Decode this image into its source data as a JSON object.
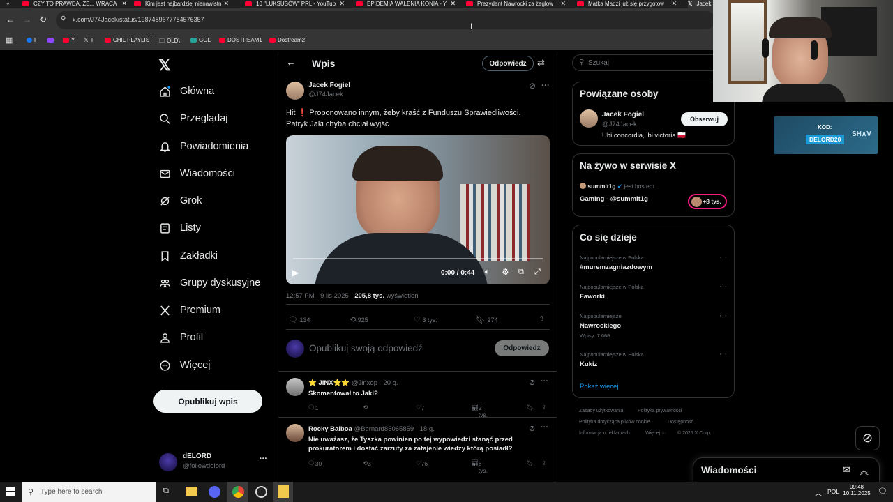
{
  "browser": {
    "tabs": [
      {
        "label": "CZY TO PRAWDA, ŻE... WRACA",
        "icon": "youtube-icon"
      },
      {
        "label": "Kim jest najbardziej nienawistn",
        "icon": "youtube-icon"
      },
      {
        "label": "10 \"LUKSUSÓW\" PRL - YouTub",
        "icon": "youtube-icon"
      },
      {
        "label": "EPIDEMIA WALENIA KONIA - Y",
        "icon": "youtube-icon"
      },
      {
        "label": "Prezydent Nawrocki za żeglow",
        "icon": "youtube-icon"
      },
      {
        "label": "Matka Madzi już się przygotow",
        "icon": "youtube-icon"
      },
      {
        "label": "Jacek",
        "icon": "x-icon"
      }
    ],
    "url": "x.com/J74Jacek/status/1987489677784576357",
    "bookmarks": [
      "F",
      "Y",
      "T",
      "CHIL PLAYLIST",
      "OLD\\",
      "GOL",
      "DOSTREAM1",
      "Dostream2"
    ]
  },
  "nav": {
    "items": [
      "Główna",
      "Przeglądaj",
      "Powiadomienia",
      "Wiadomości",
      "Grok",
      "Listy",
      "Zakładki",
      "Grupy dyskusyjne",
      "Premium",
      "Profil",
      "Więcej"
    ],
    "post_button": "Opublikuj wpis",
    "account_name": "dELORD",
    "account_handle": "@followdelord"
  },
  "header": {
    "title": "Wpis",
    "reply_button": "Odpowiedz"
  },
  "post": {
    "author_name": "Jacek Fogiel",
    "author_handle": "@J74Jacek",
    "text_line1": "Hit ❗ Proponowano innym, żeby kraść z Funduszu Sprawiedliwości.",
    "text_line2": "Patryk Jaki chyba chciał wyjść",
    "video_time": "0:00 / 0:44",
    "video_progress": 0.0,
    "timestamp": "12:57 PM · 9 lis 2025 · ",
    "views": "205,8 tys.",
    "views_label": " wyświetleń",
    "stats": {
      "replies": "134",
      "reposts": "925",
      "likes": "3 tys.",
      "bookmarks": "274"
    },
    "reply_placeholder": "Opublikuj swoją odpowiedź",
    "reply_submit": "Odpowiedz"
  },
  "replies": [
    {
      "name": "⭐ JINX⭐⭐",
      "handle": "@Jinxop · 20 g.",
      "text1": "Skomentował to Jaki?",
      "text2": "",
      "stats": [
        "1",
        "",
        "7",
        "2 tys."
      ]
    },
    {
      "name": "Rocky Balboa",
      "handle": "@Bernard85065859 · 18 g.",
      "text1": "Nie uważasz, że Tyszka powinien po tej wypowiedzi stanąć przed",
      "text2": "prokuratorem i dostać zarzuty za zatajenie wiedzy którą posiadł?",
      "stats": [
        "30",
        "3",
        "76",
        "6 tys."
      ]
    }
  ],
  "right": {
    "search_placeholder": "Szukaj",
    "related_title": "Powiązane osoby",
    "related_name": "Jacek Fogiel",
    "related_handle": "@J74Jacek",
    "related_bio": "Ubi concordia, ibi victoria 🇵🇱",
    "follow_button": "Obserwuj",
    "live_title": "Na żywo w serwisie X",
    "live_host": "summit1g",
    "live_host_label": " jest hostem",
    "live_name": "Gaming - @summit1g",
    "live_count": "+8 tys.",
    "trends_title": "Co się dzieje",
    "trends": [
      {
        "cat": "Najpopularniejsze w Polska",
        "name": "#muremzagniazdowym",
        "count": ""
      },
      {
        "cat": "Najpopularniejsze w Polska",
        "name": "Faworki",
        "count": ""
      },
      {
        "cat": "Najpopularniejsze",
        "name": "Nawrockiego",
        "count": "Wpisy: 7 668"
      },
      {
        "cat": "Najpopularniejsze w Polska",
        "name": "Kukiz",
        "count": ""
      }
    ],
    "show_more": "Pokaż więcej",
    "footer": [
      "Zasady użytkowania",
      "Polityka prywatności",
      "Polityka dotycząca plików cookie",
      "Dostępność",
      "Informacja o reklamach",
      "Więcej ···",
      "© 2025 X Corp."
    ],
    "messages_label": "Wiadomości"
  },
  "overlay": {
    "code_label": "KOD:",
    "code_value": "DELORD20",
    "brand": "SH∧V"
  },
  "taskbar": {
    "search_placeholder": "Type here to search",
    "lang": "POL",
    "time": "09:48",
    "date": "10.11.2025"
  },
  "colors": {
    "accent": "#1d9bf0",
    "brand_red": "#f91880",
    "bg": "#000000"
  }
}
